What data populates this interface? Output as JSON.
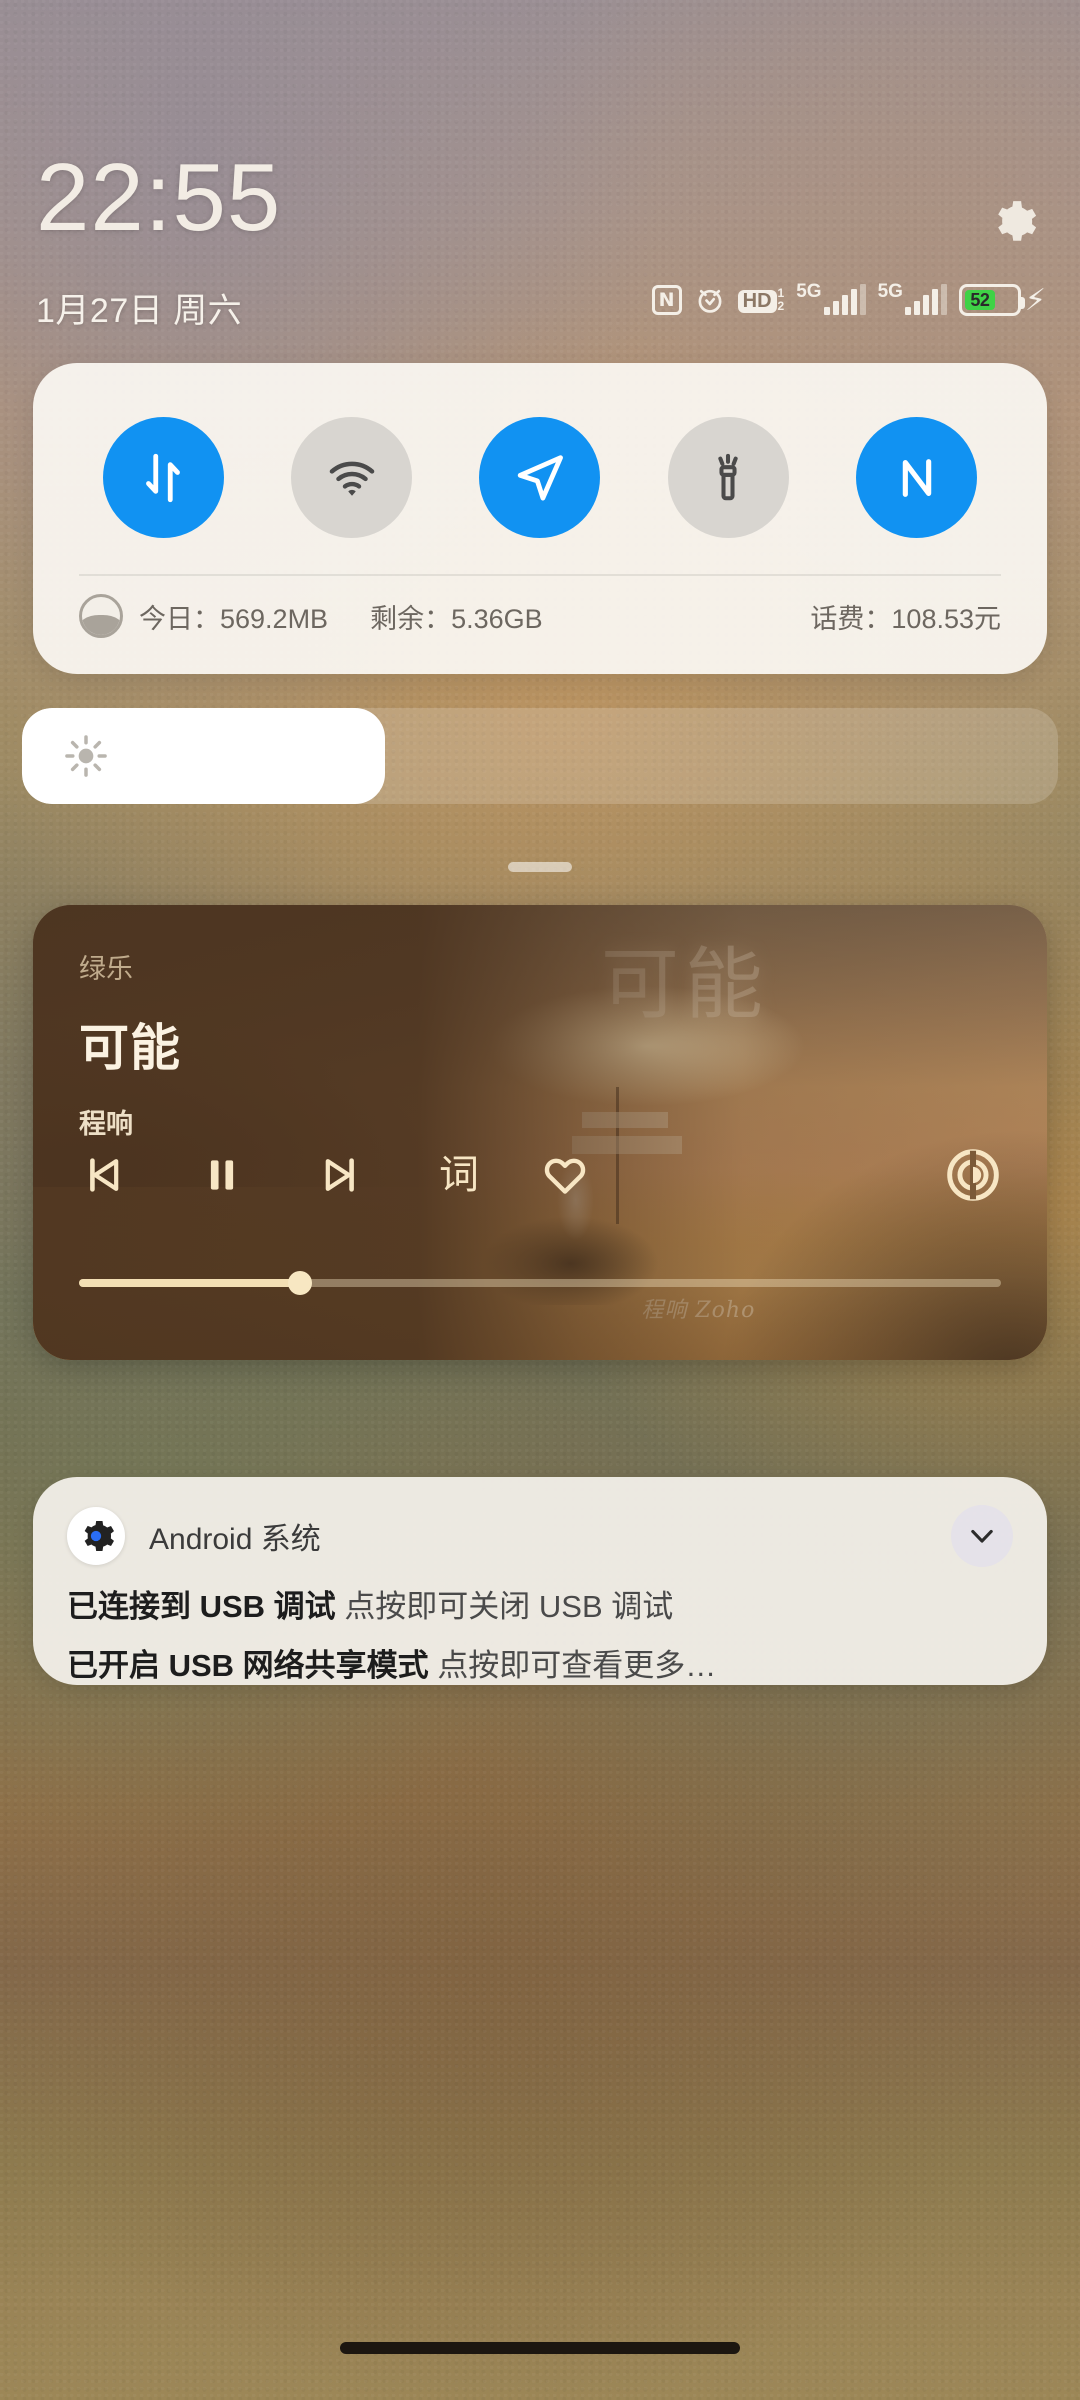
{
  "status_bar": {
    "time": "22:55",
    "date": "1月27日 周六",
    "settings_icon": "gear-icon",
    "icons": [
      {
        "name": "nfc-icon",
        "label": "N"
      },
      {
        "name": "alarm-icon",
        "label": "alarm"
      },
      {
        "name": "hd-voice-icon",
        "label": "HD",
        "sim_top": "1",
        "sim_bottom": "2"
      },
      {
        "name": "signal-sim1-icon",
        "label": "5G"
      },
      {
        "name": "signal-sim2-icon",
        "label": "5G"
      }
    ],
    "battery": {
      "percent": "52",
      "charging": true,
      "fill_color": "#3fd246"
    }
  },
  "quick_settings": {
    "toggles": [
      {
        "name": "mobile-data",
        "icon": "mobile-data-icon",
        "state": "on"
      },
      {
        "name": "wifi",
        "icon": "wifi-icon",
        "state": "off"
      },
      {
        "name": "location",
        "icon": "location-icon",
        "state": "on"
      },
      {
        "name": "flashlight",
        "icon": "flashlight-icon",
        "state": "off"
      },
      {
        "name": "nfc",
        "icon": "nfc-icon",
        "state": "on"
      }
    ],
    "accent_on": "#1192f2",
    "accent_off": "#d8d5d0",
    "data_info": {
      "today": "今日：569.2MB",
      "remaining": "剩余：5.36GB",
      "fee": "话费：108.53元"
    }
  },
  "brightness": {
    "icon": "brightness-icon",
    "level_percent": 35
  },
  "drag_handle": "panel-drag-handle",
  "media": {
    "app_name": "绿乐",
    "title": "可能",
    "artist": "程响",
    "album_art_text": "可能",
    "album_signature": "程响 Zoho",
    "controls": [
      {
        "name": "previous-button",
        "icon": "skip-previous-icon"
      },
      {
        "name": "play-pause-button",
        "icon": "pause-icon"
      },
      {
        "name": "next-button",
        "icon": "skip-next-icon"
      },
      {
        "name": "lyrics-button",
        "icon": "lyrics-icon",
        "label": "词"
      },
      {
        "name": "favorite-button",
        "icon": "heart-icon"
      },
      {
        "name": "cast-button",
        "icon": "cast-audio-icon"
      }
    ],
    "progress_percent": 24
  },
  "notification": {
    "app_name": "Android 系统",
    "app_icon": "android-settings-gear-icon",
    "expand_icon": "chevron-down-icon",
    "lines": [
      {
        "bold": "已连接到 USB 调试",
        "rest": "点按即可关闭 USB 调试"
      },
      {
        "bold": "已开启 USB 网络共享模式",
        "rest": "点按即可查看更多…"
      }
    ]
  },
  "navigation_bar": "gesture-pill"
}
